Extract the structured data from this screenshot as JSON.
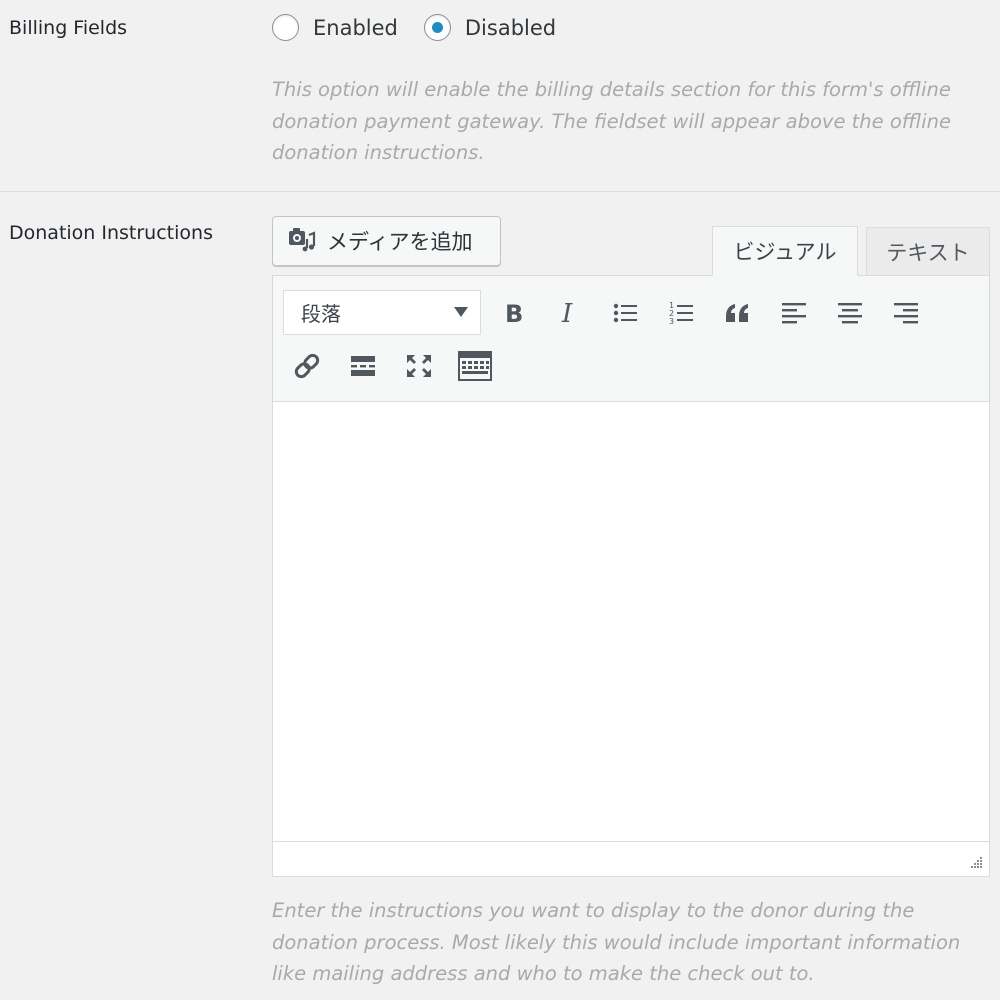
{
  "billing": {
    "label": "Billing Fields",
    "options": [
      {
        "label": "Enabled",
        "selected": false
      },
      {
        "label": "Disabled",
        "selected": true
      }
    ],
    "description": "This option will enable the billing details section for this form's offline donation payment gateway. The fieldset will appear above the offline donation instructions."
  },
  "donation": {
    "label": "Donation Instructions",
    "media_button": {
      "label": "メディアを追加",
      "icon": "media-add-icon"
    },
    "tabs": [
      {
        "label": "ビジュアル",
        "active": true
      },
      {
        "label": "テキスト",
        "active": false
      }
    ],
    "toolbar": {
      "format_select": "段落",
      "buttons": [
        "bold",
        "italic",
        "bulleted-list",
        "numbered-list",
        "blockquote",
        "align-left",
        "align-center",
        "align-right",
        "insert-link",
        "read-more",
        "fullscreen",
        "toolbar-toggle"
      ]
    },
    "content": "",
    "description": "Enter the instructions you want to display to the donor during the donation process. Most likely this would include important information like mailing address and who to make the check out to."
  },
  "colors": {
    "radio_accent": "#1e8cbe",
    "description_text": "#a7aaad",
    "background": "#f1f1f1"
  }
}
